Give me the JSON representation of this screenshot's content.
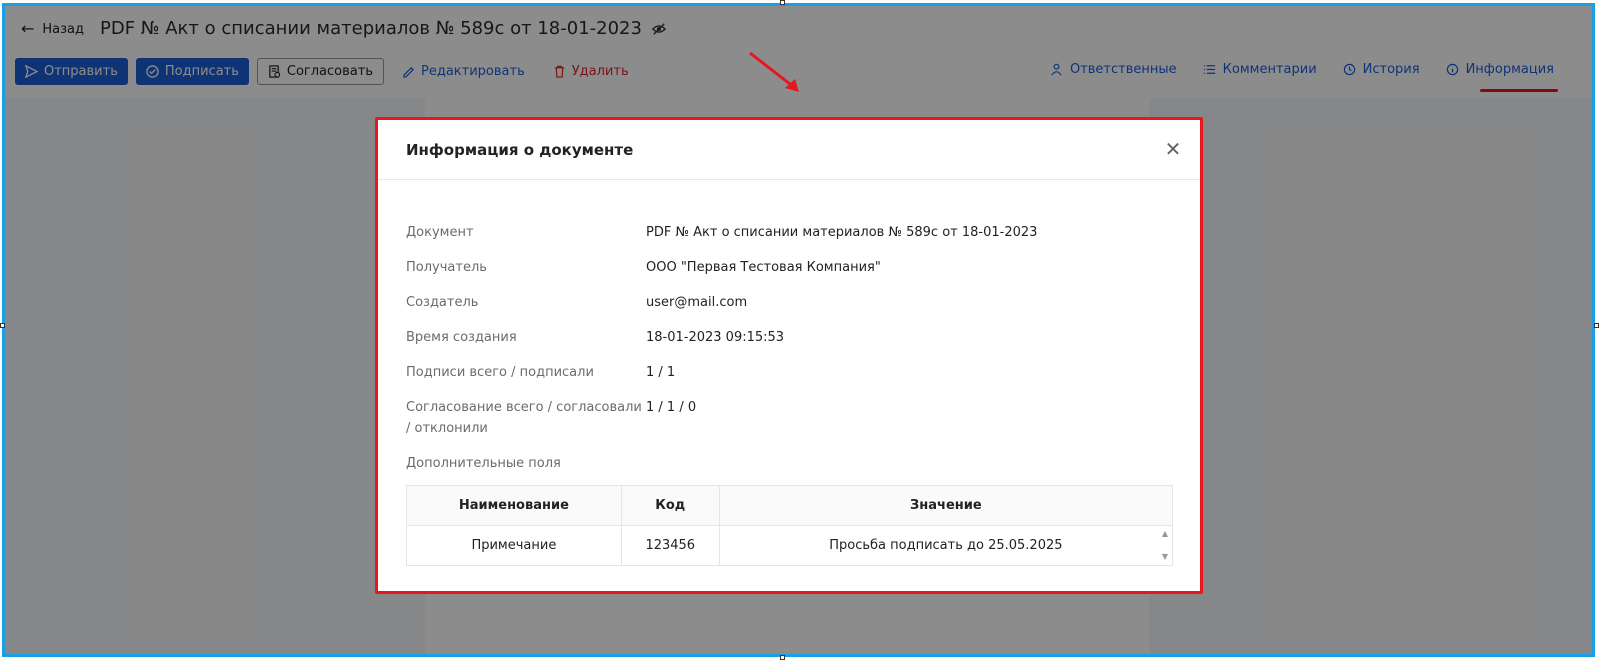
{
  "header": {
    "back_label": "Назад",
    "doc_title": "PDF № Акт о списании материалов № 589с от 18-01-2023"
  },
  "toolbar": {
    "send_label": "Отправить",
    "sign_label": "Подписать",
    "approve_label": "Согласовать",
    "edit_label": "Редактировать",
    "delete_label": "Удалить"
  },
  "right_nav": {
    "responsible_label": "Ответственные",
    "comments_label": "Комментарии",
    "history_label": "История",
    "info_label": "Информация"
  },
  "modal": {
    "title": "Информация о документе",
    "rows": [
      {
        "label": "Документ",
        "value": "PDF № Акт о списании материалов № 589с от 18-01-2023"
      },
      {
        "label": "Получатель",
        "value": "ООО \"Первая Тестовая Компания\""
      },
      {
        "label": "Создатель",
        "value": "user@mail.com"
      },
      {
        "label": "Время создания",
        "value": "18-01-2023 09:15:53"
      },
      {
        "label": "Подписи всего / подписали",
        "value": "1 / 1"
      },
      {
        "label": "Согласование всего / согласовали / отклонили",
        "value": "1 / 1 / 0"
      },
      {
        "label": "Дополнительные поля",
        "value": ""
      }
    ],
    "table": {
      "headers": [
        "Наименование",
        "Код",
        "Значение"
      ],
      "rows": [
        [
          "Примечание",
          "123456",
          "Просьба подписать до 25.05.2025"
        ]
      ]
    }
  },
  "colors": {
    "accent": "#1d5fd8",
    "danger": "#e02424",
    "highlight": "#e8171c",
    "frame": "#1a9ee6"
  }
}
